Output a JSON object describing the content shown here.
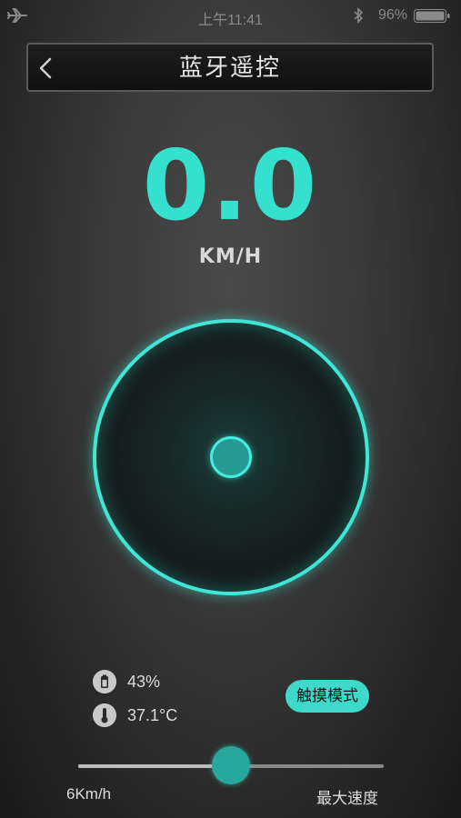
{
  "status_bar": {
    "airplane_icon": "airplane-icon",
    "time": "上午11:41",
    "bluetooth_icon": "bluetooth-icon",
    "battery_percent": "96%",
    "battery_icon": "battery-icon"
  },
  "header": {
    "back_icon": "chevron-left-icon",
    "title": "蓝牙遥控"
  },
  "speed": {
    "value": "0.0",
    "unit": "KM/H"
  },
  "joystick": {
    "knob_position": "center"
  },
  "stats": {
    "battery_icon": "battery-icon",
    "battery": "43%",
    "temperature_icon": "thermometer-icon",
    "temperature": "37.1°C"
  },
  "mode_button": {
    "label": "触摸模式"
  },
  "speed_slider": {
    "min_label": "6Km/h",
    "max_label": "最大速度",
    "value_fraction": 0.5
  },
  "colors": {
    "accent": "#3fe6d6",
    "knob": "#249a92",
    "background": "#333333"
  }
}
